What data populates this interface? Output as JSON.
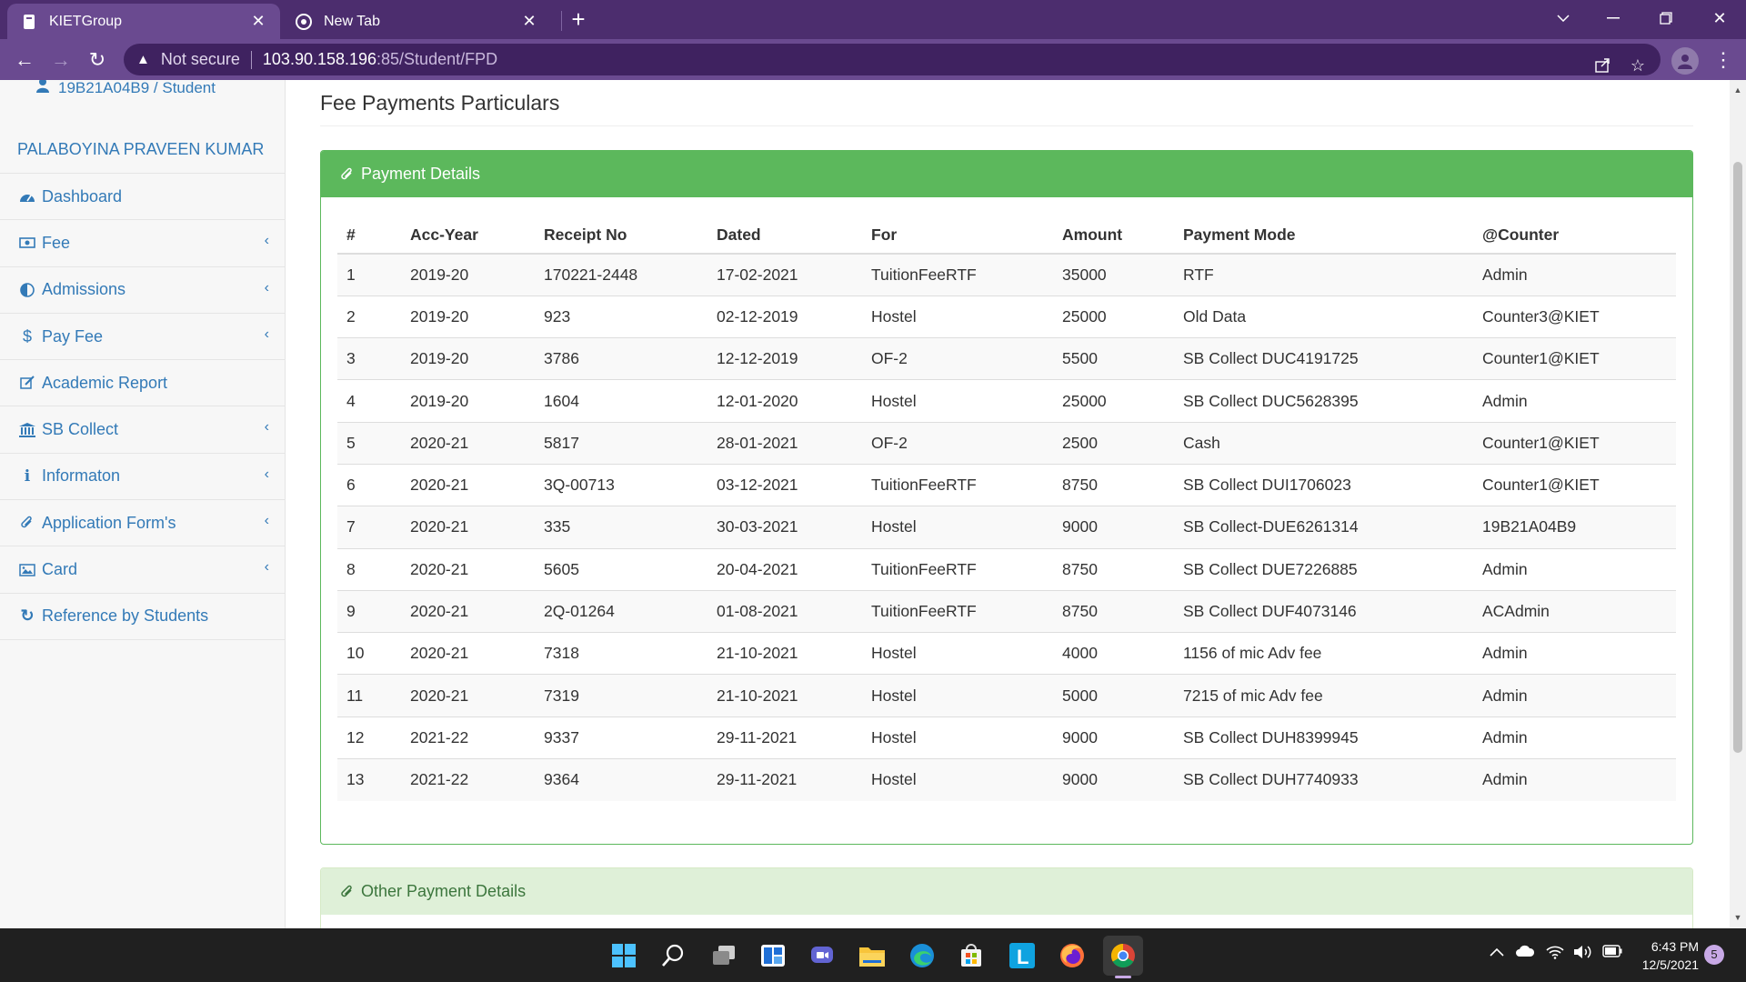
{
  "browser": {
    "tabs": [
      {
        "title": "KIETGroup",
        "active": true
      },
      {
        "title": "New Tab",
        "active": false
      }
    ],
    "address": {
      "security_label": "Not secure",
      "host": "103.90.158.196",
      "path": ":85/Student/FPD"
    }
  },
  "sidebar": {
    "user_line": "19B21A04B9 / Student",
    "student_name": "PALABOYINA PRAVEEN KUMAR",
    "items": [
      {
        "label": "Dashboard",
        "icon": "dashboard-icon",
        "has_submenu": false
      },
      {
        "label": "Fee",
        "icon": "money-icon",
        "has_submenu": true
      },
      {
        "label": "Admissions",
        "icon": "adjust-icon",
        "has_submenu": true
      },
      {
        "label": "Pay Fee",
        "icon": "dollar-icon",
        "has_submenu": true
      },
      {
        "label": "Academic Report",
        "icon": "edit-icon",
        "has_submenu": false
      },
      {
        "label": "SB Collect",
        "icon": "bank-icon",
        "has_submenu": true
      },
      {
        "label": "Informaton",
        "icon": "info-icon",
        "has_submenu": true
      },
      {
        "label": "Application Form's",
        "icon": "paperclip-icon",
        "has_submenu": true
      },
      {
        "label": "Card",
        "icon": "image-icon",
        "has_submenu": true
      },
      {
        "label": "Reference by Students",
        "icon": "refresh-icon",
        "has_submenu": false
      }
    ]
  },
  "main": {
    "page_title": "Fee Payments Particulars",
    "payment_panel_title": "Payment Details",
    "other_panel_title": "Other Payment Details",
    "table": {
      "headers": [
        "#",
        "Acc-Year",
        "Receipt No",
        "Dated",
        "For",
        "Amount",
        "Payment Mode",
        "@Counter"
      ],
      "rows": [
        [
          "1",
          "2019-20",
          "170221-2448",
          "17-02-2021",
          "TuitionFeeRTF",
          "35000",
          "RTF",
          "Admin"
        ],
        [
          "2",
          "2019-20",
          "923",
          "02-12-2019",
          "Hostel",
          "25000",
          "Old Data",
          "Counter3@KIET"
        ],
        [
          "3",
          "2019-20",
          "3786",
          "12-12-2019",
          "OF-2",
          "5500",
          "SB Collect DUC4191725",
          "Counter1@KIET"
        ],
        [
          "4",
          "2019-20",
          "1604",
          "12-01-2020",
          "Hostel",
          "25000",
          "SB Collect DUC5628395",
          "Admin"
        ],
        [
          "5",
          "2020-21",
          "5817",
          "28-01-2021",
          "OF-2",
          "2500",
          "Cash",
          "Counter1@KIET"
        ],
        [
          "6",
          "2020-21",
          "3Q-00713",
          "03-12-2021",
          "TuitionFeeRTF",
          "8750",
          "SB Collect DUI1706023",
          "Counter1@KIET"
        ],
        [
          "7",
          "2020-21",
          "335",
          "30-03-2021",
          "Hostel",
          "9000",
          "SB Collect-DUE6261314",
          "19B21A04B9"
        ],
        [
          "8",
          "2020-21",
          "5605",
          "20-04-2021",
          "TuitionFeeRTF",
          "8750",
          "SB Collect DUE7226885",
          "Admin"
        ],
        [
          "9",
          "2020-21",
          "2Q-01264",
          "01-08-2021",
          "TuitionFeeRTF",
          "8750",
          "SB Collect DUF4073146",
          "ACAdmin"
        ],
        [
          "10",
          "2020-21",
          "7318",
          "21-10-2021",
          "Hostel",
          "4000",
          "1156 of mic Adv fee",
          "Admin"
        ],
        [
          "11",
          "2020-21",
          "7319",
          "21-10-2021",
          "Hostel",
          "5000",
          "7215 of mic Adv fee",
          "Admin"
        ],
        [
          "12",
          "2021-22",
          "9337",
          "29-11-2021",
          "Hostel",
          "9000",
          "SB Collect DUH8399945",
          "Admin"
        ],
        [
          "13",
          "2021-22",
          "9364",
          "29-11-2021",
          "Hostel",
          "9000",
          "SB Collect DUH7740933",
          "Admin"
        ]
      ]
    }
  },
  "taskbar": {
    "apps": [
      "start-icon",
      "search-icon",
      "task-view-icon",
      "widgets-icon",
      "chat-icon",
      "file-explorer-icon",
      "edge-icon",
      "store-icon",
      "l-app-icon",
      "firefox-icon",
      "chrome-icon"
    ],
    "time": "6:43 PM",
    "date": "12/5/2021",
    "notification_count": "5"
  },
  "colors": {
    "browser_frame": "#4c2d6e",
    "panel_green": "#5cb85c",
    "link_blue": "#337ab7"
  }
}
